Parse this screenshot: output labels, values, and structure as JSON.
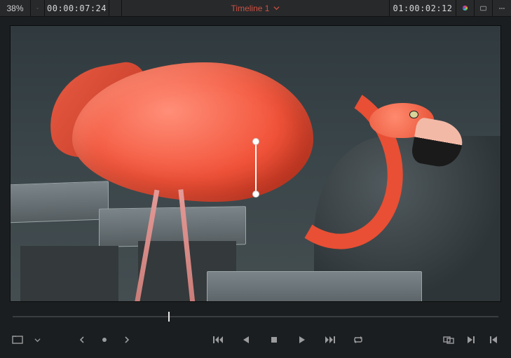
{
  "topbar": {
    "zoom_label": "38%",
    "source_timecode": "00:00:07:24",
    "title": "Timeline 1",
    "record_timecode": "01:00:02:12"
  },
  "scrub": {
    "playhead_percent": 32
  },
  "overlay": {
    "tracker_present": true
  },
  "icons": {
    "chevron_down": "chevron-down",
    "color_wheel": "color-wheel",
    "display_presets": "display-presets",
    "options": "options-menu",
    "image_wipe": "image-wipe",
    "bypass": "bypass",
    "prev_keyframe": "prev-keyframe",
    "add_keyframe": "add-keyframe",
    "next_keyframe": "next-keyframe",
    "first_frame": "first-frame",
    "reverse": "reverse-play",
    "stop": "stop",
    "play": "play",
    "last_frame": "last-frame",
    "loop": "loop",
    "match_frame": "match-frame",
    "next_clip": "next-clip",
    "prev_clip": "prev-clip"
  }
}
